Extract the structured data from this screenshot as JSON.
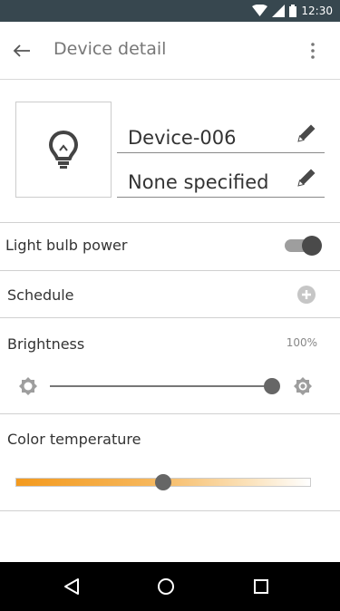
{
  "status_bar": {
    "time": "12:30"
  },
  "app_bar": {
    "title": "Device detail"
  },
  "device": {
    "name": "Device-006",
    "location": "None specified"
  },
  "power": {
    "label": "Light bulb power",
    "on": true
  },
  "schedule": {
    "label": "Schedule"
  },
  "brightness": {
    "label": "Brightness",
    "value_text": "100%",
    "level": 1.0
  },
  "color_temperature": {
    "label": "Color temperature",
    "level": 0.5
  },
  "colors": {
    "status_bar": "#37474f",
    "temp_warm": "#f39a1e",
    "temp_cool": "#ffffff"
  }
}
